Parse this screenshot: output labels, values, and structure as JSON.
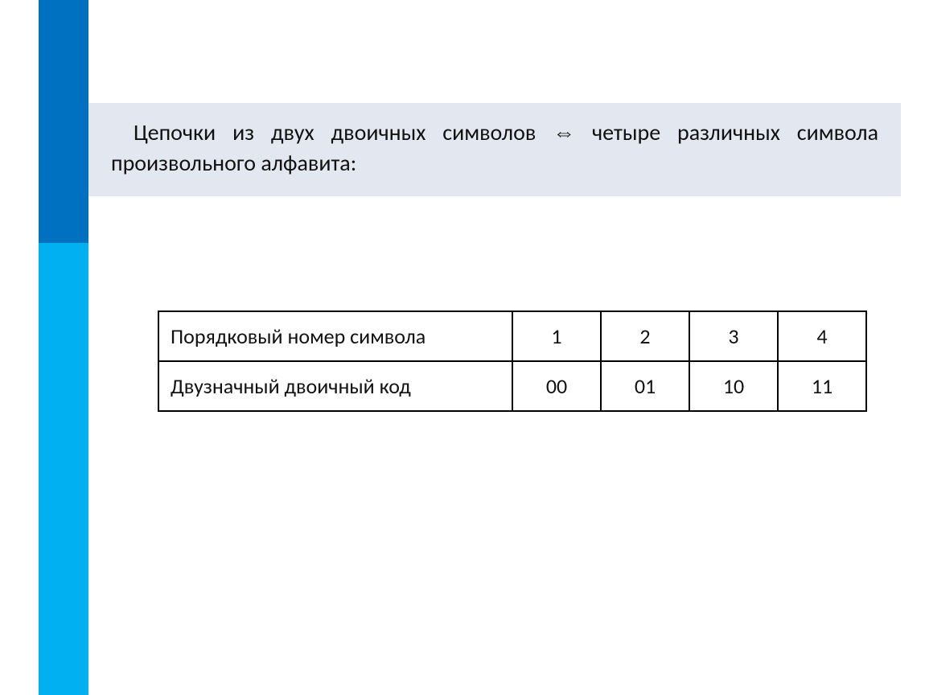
{
  "heading": {
    "part1": "Цепочки из двух двоичных символов ",
    "arrow": "⇔",
    "part2": " четыре различных символа произвольного алфавита:"
  },
  "table": {
    "rows": [
      {
        "label": "Порядковый номер символа",
        "values": [
          "1",
          "2",
          "3",
          "4"
        ]
      },
      {
        "label": "Двузначный двоичный код",
        "values": [
          "00",
          "01",
          "10",
          "11"
        ]
      }
    ]
  },
  "chart_data": {
    "type": "table",
    "columns": [
      "Порядковый номер символа",
      "Двузначный двоичный код"
    ],
    "rows": [
      {
        "Порядковый номер символа": 1,
        "Двузначный двоичный код": "00"
      },
      {
        "Порядковый номер символа": 2,
        "Двузначный двоичный код": "01"
      },
      {
        "Порядковый номер символа": 3,
        "Двузначный двоичный код": "10"
      },
      {
        "Порядковый номер символа": 4,
        "Двузначный двоичный код": "11"
      }
    ]
  }
}
